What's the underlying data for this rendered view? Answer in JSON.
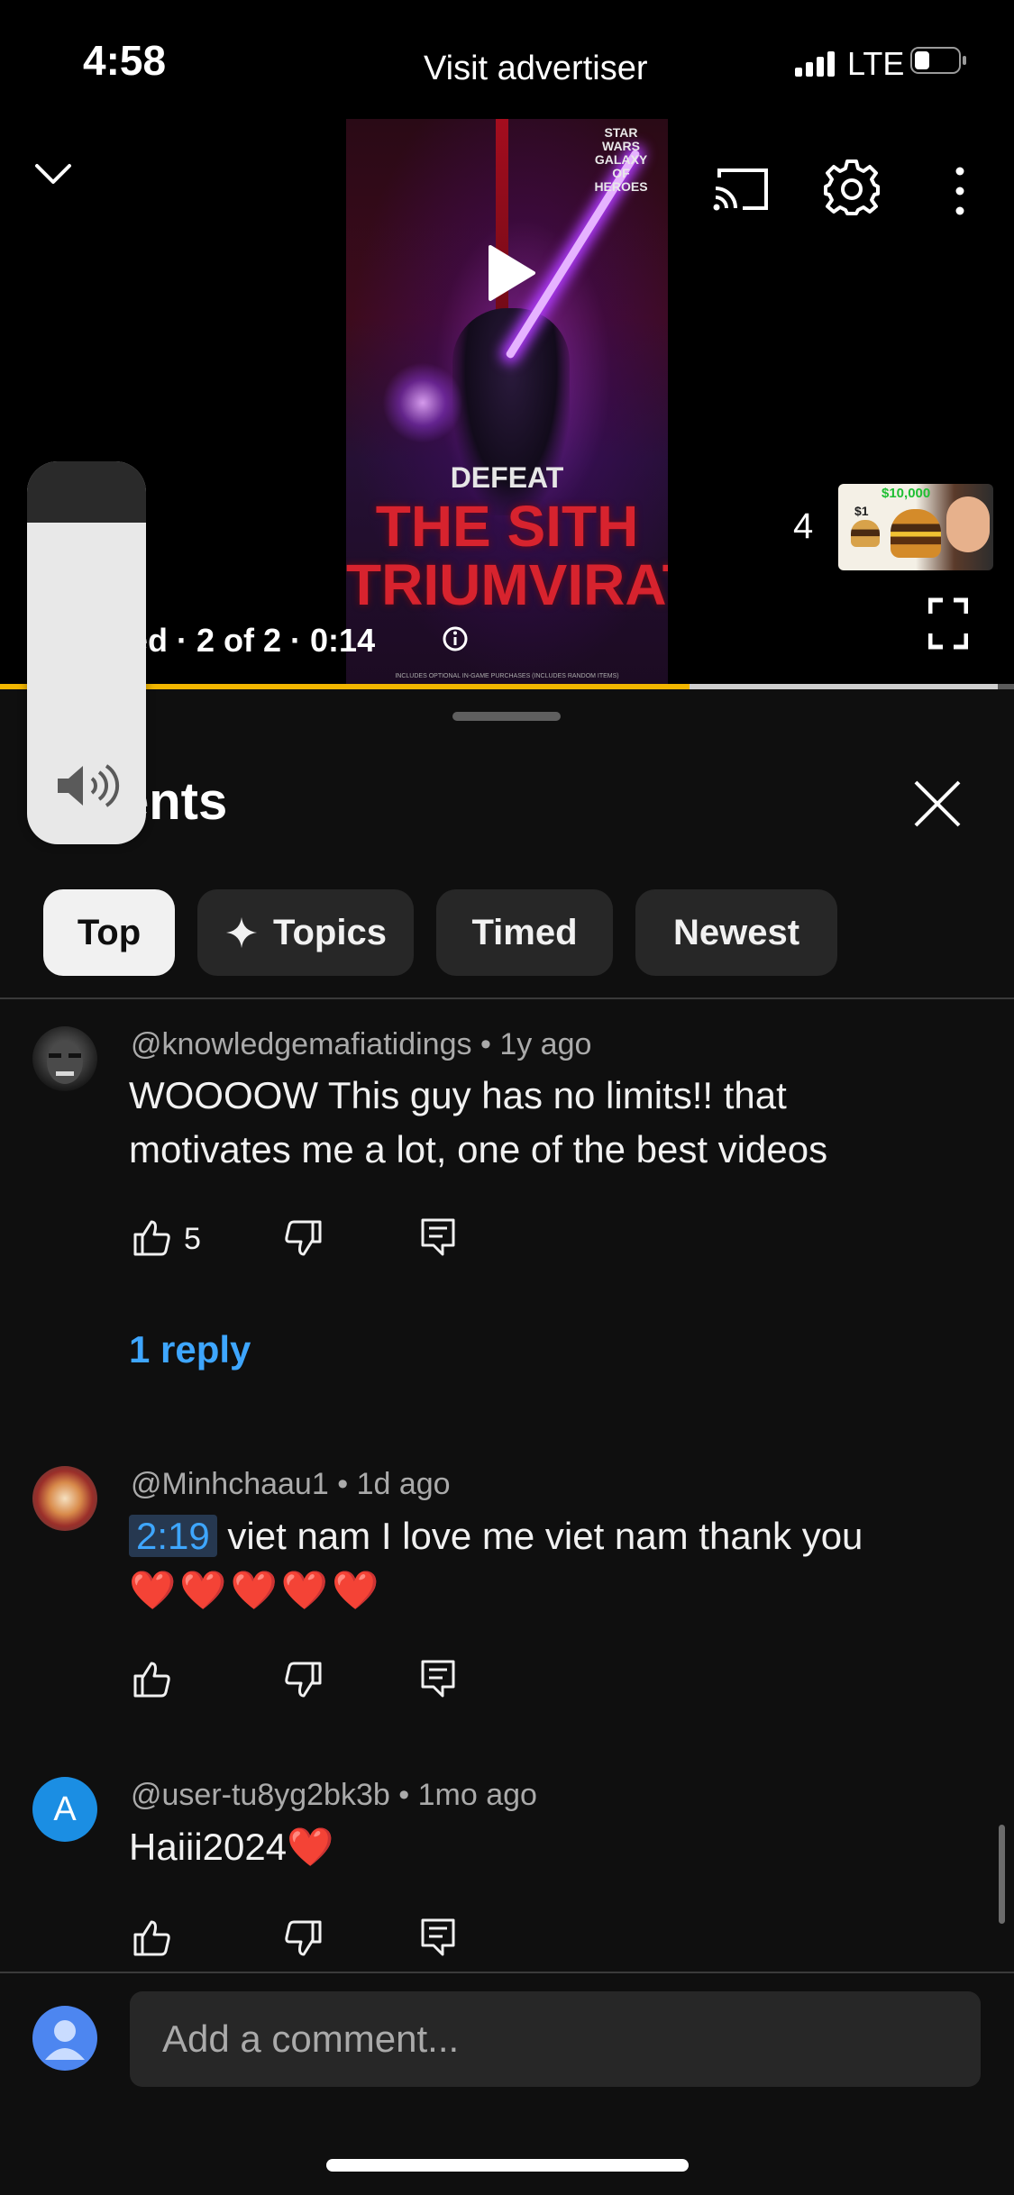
{
  "status_bar": {
    "time": "4:58",
    "network": "LTE",
    "battery_level": 0.35
  },
  "player": {
    "visit_advertiser": "Visit advertiser",
    "ad_info": "red · 2 of 2 · 0:14",
    "queue_count": "4",
    "next_thumb_price": "$10,000",
    "next_thumb_small_price": "$1",
    "progress_fraction": 0.68,
    "ad": {
      "logo": "STAR WARS GALAXY OF HEROES",
      "kicker": "DEFEAT",
      "headline_1": "THE SITH",
      "headline_2": "TRIUMVIRATE",
      "fine_print": "INCLUDES OPTIONAL IN-GAME PURCHASES (INCLUDES RANDOM ITEMS)"
    }
  },
  "volume": {
    "level": 0.84
  },
  "panel": {
    "title": "nments"
  },
  "chips": [
    {
      "label": "Top",
      "active": true
    },
    {
      "label": "Topics",
      "active": false
    },
    {
      "label": "Timed",
      "active": false
    },
    {
      "label": "Newest",
      "active": false
    }
  ],
  "comments": [
    {
      "author": "@knowledgemafiatidings",
      "age": "1y ago",
      "text_line_1": "WOOOOW This guy has no limits!! that",
      "text_line_2": "motivates me a lot, one of the best videos",
      "likes": "5",
      "reply_link": "1 reply"
    },
    {
      "author": "@Minhchaau1",
      "age": "1d ago",
      "timestamp": "2:19",
      "text_line_1": "viet nam I love me viet nam thank you",
      "text_line_2": "❤️❤️❤️❤️❤️"
    },
    {
      "author": "@user-tu8yg2bk3b",
      "age": "1mo ago",
      "avatar_letter": "A",
      "text_line_1": "Haiii2024",
      "text_emoji": "❤️"
    }
  ],
  "composer": {
    "placeholder": "Add a comment..."
  },
  "colors": {
    "accent_link": "#3ea6ff",
    "progress": "#f2b600",
    "chip_active": "#f1f1f1",
    "chip_bg": "#272727"
  },
  "icons": [
    "chevron-down-icon",
    "cast-icon",
    "gear-icon",
    "more-vert-icon",
    "play-icon",
    "fullscreen-icon",
    "info-icon",
    "volume-icon",
    "close-icon",
    "sparkle-icon",
    "thumb-up-icon",
    "thumb-down-icon",
    "reply-icon",
    "user-avatar-icon"
  ]
}
